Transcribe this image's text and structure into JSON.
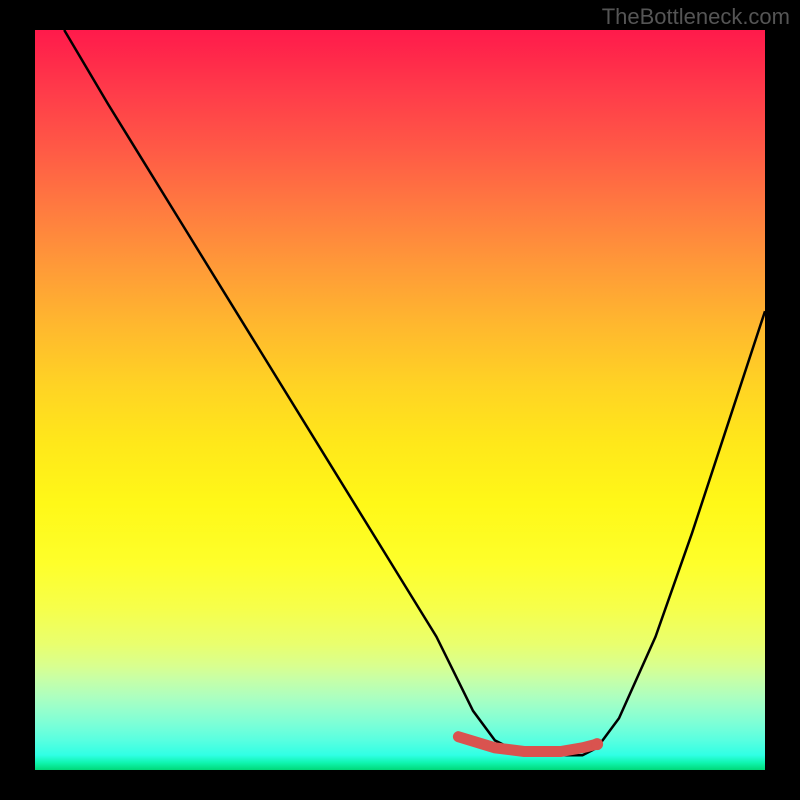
{
  "watermark": "TheBottleneck.com",
  "chart_data": {
    "type": "line",
    "title": "",
    "xlabel": "",
    "ylabel": "",
    "xlim": [
      0,
      100
    ],
    "ylim": [
      0,
      100
    ],
    "series": [
      {
        "name": "curve",
        "x": [
          4,
          10,
          20,
          30,
          40,
          50,
          55,
          58,
          60,
          63,
          67,
          72,
          75,
          77,
          80,
          85,
          90,
          95,
          100
        ],
        "y": [
          100,
          90,
          74,
          58,
          42,
          26,
          18,
          12,
          8,
          4,
          2,
          2,
          2,
          3,
          7,
          18,
          32,
          47,
          62
        ]
      },
      {
        "name": "highlight",
        "x": [
          58,
          63,
          67,
          72,
          75,
          77
        ],
        "y": [
          4.5,
          3,
          2.5,
          2.5,
          3,
          3.5
        ]
      }
    ],
    "colors": {
      "curve": "#000000",
      "highlight": "#d9534f",
      "highlight_dot": "#d9534f"
    },
    "gradient_stops": [
      {
        "pct": 0,
        "color": "#ff1a4b"
      },
      {
        "pct": 50,
        "color": "#ffe020"
      },
      {
        "pct": 100,
        "color": "#00d878"
      }
    ]
  }
}
